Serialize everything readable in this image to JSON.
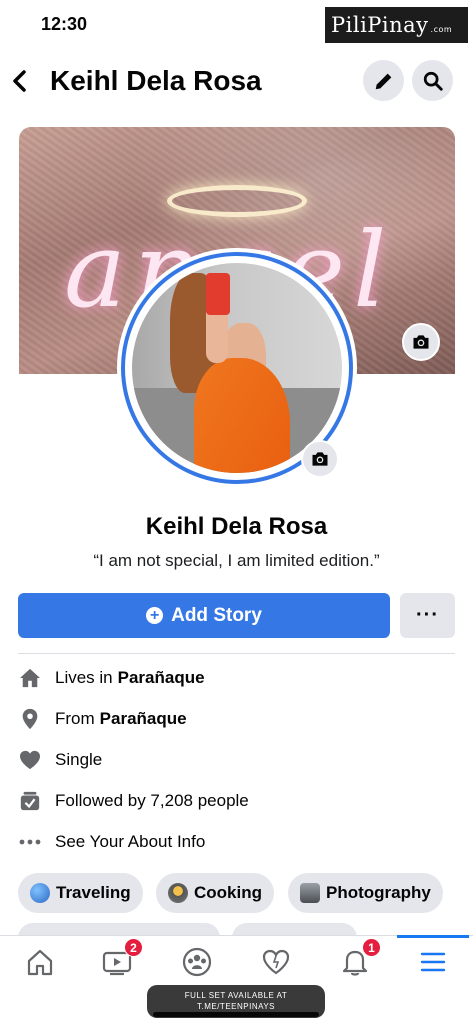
{
  "status_bar": {
    "time": "12:30"
  },
  "watermark": {
    "brand": "PiliPinay",
    "suffix": ".com"
  },
  "header": {
    "title": "Keihl Dela Rosa",
    "back_icon": "chevron-left-icon",
    "edit_icon": "pencil-icon",
    "search_icon": "search-icon"
  },
  "cover": {
    "overlay_word": "angel",
    "camera_icon": "camera-icon"
  },
  "profile": {
    "name": "Keihl Dela Rosa",
    "bio": "“I am not special, I am limited edition.”"
  },
  "actions": {
    "add_story": "Add Story",
    "more": "···"
  },
  "info": [
    {
      "icon": "home-icon",
      "prefix": "Lives in",
      "value": "Parañaque"
    },
    {
      "icon": "location-pin-icon",
      "prefix": "From",
      "value": "Parañaque"
    },
    {
      "icon": "heart-icon",
      "prefix": "Single",
      "value": ""
    },
    {
      "icon": "followers-icon",
      "prefix": "Followed by 7,208 people",
      "value": ""
    },
    {
      "icon": "dots-icon",
      "prefix": "See Your About Info",
      "value": ""
    }
  ],
  "hobbies": [
    {
      "label": "Traveling",
      "icon": "globe-icon"
    },
    {
      "label": "Cooking",
      "icon": "cooking-icon"
    },
    {
      "label": "Photography",
      "icon": "camera-icon"
    }
  ],
  "tabbar": {
    "tabs": [
      {
        "name": "home",
        "icon": "home-outline-icon",
        "badge": ""
      },
      {
        "name": "watch",
        "icon": "video-icon",
        "badge": "2"
      },
      {
        "name": "groups",
        "icon": "groups-icon",
        "badge": ""
      },
      {
        "name": "dating",
        "icon": "heart-outline-icon",
        "badge": ""
      },
      {
        "name": "notifications",
        "icon": "bell-icon",
        "badge": "1"
      },
      {
        "name": "menu",
        "icon": "menu-icon",
        "badge": ""
      }
    ],
    "active": "menu"
  },
  "promo": {
    "line1": "FULL SET AVAILABLE AT",
    "line2": "T.ME/TEENPINAYS"
  },
  "colors": {
    "accent": "#3578e5",
    "badge": "#e41e3f",
    "chip": "#e4e6eb"
  }
}
